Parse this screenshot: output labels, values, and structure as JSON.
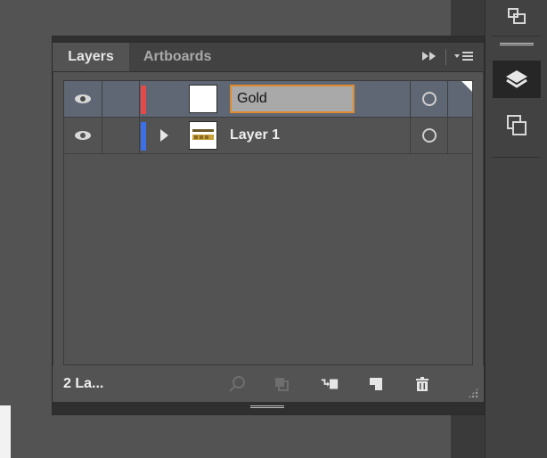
{
  "panel": {
    "tabs": [
      {
        "label": "Layers",
        "active": true
      },
      {
        "label": "Artboards",
        "active": false
      }
    ]
  },
  "layers": [
    {
      "name": "Gold",
      "editing": true,
      "color": "#e24a4a",
      "has_children": false,
      "thumbnail": "blank-white"
    },
    {
      "name": "Layer 1",
      "editing": false,
      "color": "#3d6fe6",
      "has_children": true,
      "thumbnail": "gold-text-art"
    }
  ],
  "footer": {
    "layer_count": "2 La..."
  },
  "icons": {
    "visibility": "eye-icon",
    "target": "target-circle-icon",
    "expand": "triangle-right-icon",
    "locate": "search-icon",
    "clipping_mask": "clipping-mask-icon",
    "new_sublayer": "new-sublayer-icon",
    "new_layer": "new-layer-icon",
    "delete": "trash-icon",
    "collapse_panel": "double-arrow-right-icon",
    "menu": "panel-menu-icon",
    "dock_top": "artboard-dock-icon",
    "dock_layers": "layers-icon",
    "dock_artboards": "artboards-icon"
  }
}
